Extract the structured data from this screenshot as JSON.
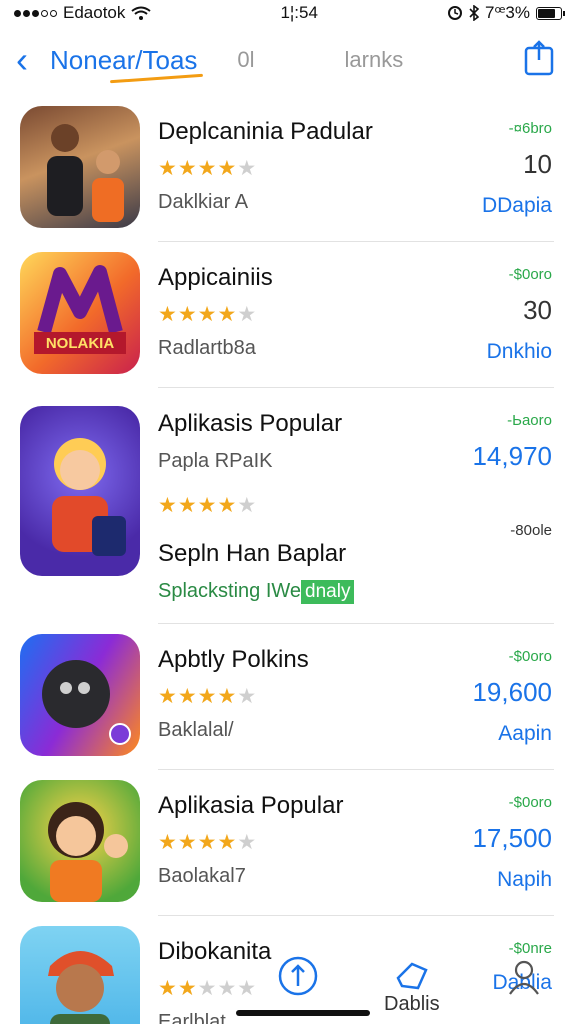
{
  "status_bar": {
    "carrier": "Edaotok",
    "time": "1¦:54",
    "battery": "7ꟹ3%"
  },
  "nav": {
    "title": "Nonear/Toas",
    "segment_1": "0l",
    "segment_2": "larnks"
  },
  "apps": [
    {
      "name": "Deplcaninia Padular",
      "rating": 4,
      "subtitle": "Daklkiar A",
      "price": "-¤6bro",
      "count": "10",
      "count_style": "plain",
      "action": "DDapia"
    },
    {
      "name": "Appicainiis",
      "rating": 4,
      "subtitle": "Radlartb8a",
      "price": "-$0oro",
      "count": "30",
      "count_style": "plain",
      "action": "Dnkhio"
    },
    {
      "name": "Aplikasis Popular",
      "rating": 4,
      "subtitle": "Papla RPaIK",
      "price": "-Ьaoro",
      "count": "14,970",
      "count_style": "blue",
      "action": "",
      "extra": {
        "name": "Sepln Han Baplar",
        "price": "-80ole",
        "subtitle_plain": "Splacksting",
        "subtitle_badge": "IWe",
        "badge_text": "dnaly"
      }
    },
    {
      "name": "Apbtly Polkins",
      "rating": 4,
      "subtitle": "Baklalal/",
      "price": "-$0oro",
      "count": "19,600",
      "count_style": "blue",
      "action": "Aapin"
    },
    {
      "name": "Aplikasia Popular",
      "rating": 4,
      "subtitle": "Baolakal7",
      "price": "-$0oro",
      "count": "17,500",
      "count_style": "blue",
      "action": "Napih"
    },
    {
      "name": "Dibokanita",
      "rating": 2,
      "subtitle": "Earlblat",
      "price": "-$0nre",
      "count": "",
      "count_style": "plain",
      "action": "Dablia"
    }
  ],
  "tab_bar": {
    "label_center": "Dablis"
  },
  "colors": {
    "accent": "#1a73e8",
    "star": "#f2a71b",
    "price": "#2aa84a"
  }
}
